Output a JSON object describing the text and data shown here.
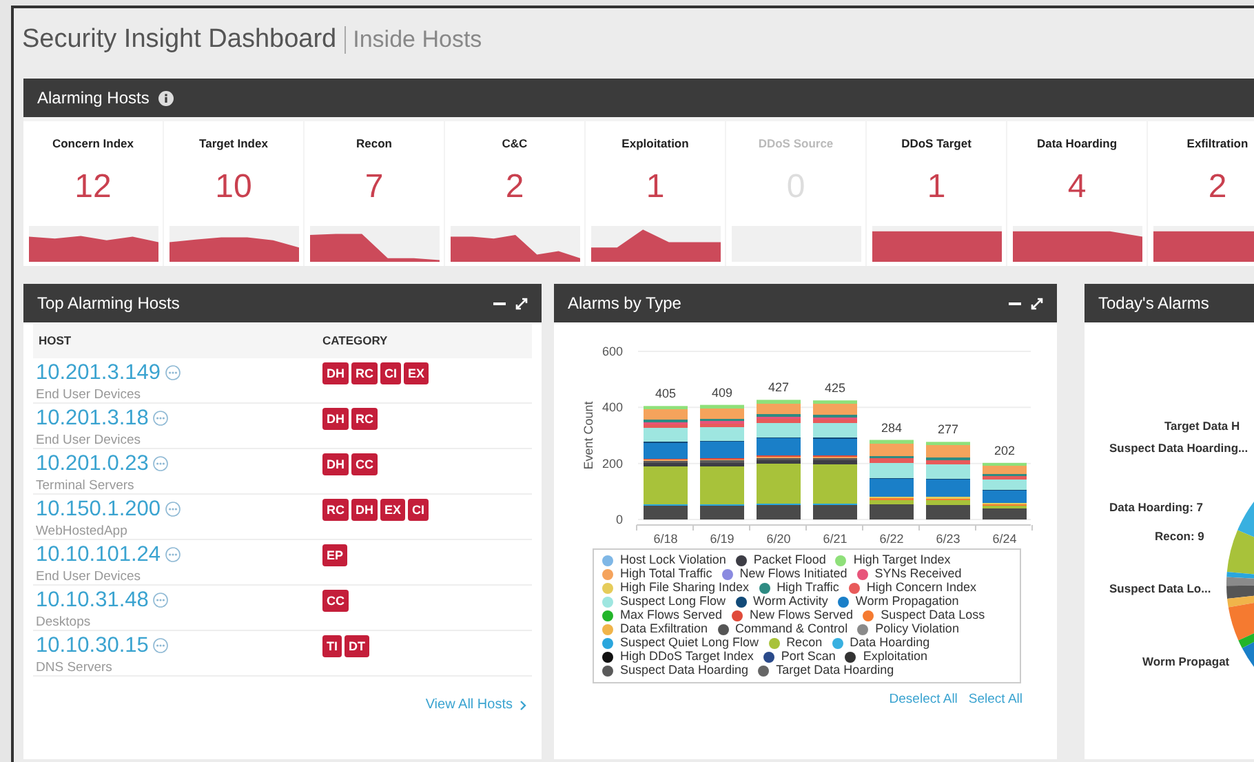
{
  "header": {
    "title": "Security Insight Dashboard",
    "subtitle": "Inside Hosts"
  },
  "alarming_hosts": {
    "title": "Alarming Hosts",
    "tiles": [
      {
        "label": "Concern Index",
        "value": "12",
        "disabled": false
      },
      {
        "label": "Target Index",
        "value": "10",
        "disabled": false
      },
      {
        "label": "Recon",
        "value": "7",
        "disabled": false
      },
      {
        "label": "C&C",
        "value": "2",
        "disabled": false
      },
      {
        "label": "Exploitation",
        "value": "1",
        "disabled": false
      },
      {
        "label": "DDoS Source",
        "value": "0",
        "disabled": true
      },
      {
        "label": "DDoS Target",
        "value": "1",
        "disabled": false
      },
      {
        "label": "Data Hoarding",
        "value": "4",
        "disabled": false
      },
      {
        "label": "Exfiltration",
        "value": "2",
        "disabled": false
      }
    ]
  },
  "top_alarming_hosts": {
    "title": "Top Alarming Hosts",
    "columns": [
      "HOST",
      "CATEGORY"
    ],
    "rows": [
      {
        "host": "10.201.3.149",
        "group": "End User Devices",
        "categories": [
          "DH",
          "RC",
          "CI",
          "EX"
        ]
      },
      {
        "host": "10.201.3.18",
        "group": "End User Devices",
        "categories": [
          "DH",
          "RC"
        ]
      },
      {
        "host": "10.201.0.23",
        "group": "Terminal Servers",
        "categories": [
          "DH",
          "CC"
        ]
      },
      {
        "host": "10.150.1.200",
        "group": "WebHostedApp",
        "categories": [
          "RC",
          "DH",
          "EX",
          "CI"
        ]
      },
      {
        "host": "10.10.101.24",
        "group": "End User Devices",
        "categories": [
          "EP"
        ]
      },
      {
        "host": "10.10.31.48",
        "group": "Desktops",
        "categories": [
          "CC"
        ]
      },
      {
        "host": "10.10.30.15",
        "group": "DNS Servers",
        "categories": [
          "TI",
          "DT"
        ]
      }
    ],
    "link": "View All Hosts"
  },
  "alarms_by_type": {
    "title": "Alarms by Type",
    "chart_data": {
      "type": "bar",
      "ylabel": "Event Count",
      "categories": [
        "6/18",
        "6/19",
        "6/20",
        "6/21",
        "6/22",
        "6/23",
        "6/24"
      ],
      "values": [
        405,
        409,
        427,
        425,
        284,
        277,
        202
      ],
      "ylim": [
        0,
        600
      ],
      "yticks": [
        0,
        200,
        400,
        600
      ],
      "data_labels": true
    },
    "legend": [
      {
        "name": "Host Lock Violation",
        "color": "#7fb7e6"
      },
      {
        "name": "Packet Flood",
        "color": "#3d3d45"
      },
      {
        "name": "High Target Index",
        "color": "#8fe07a"
      },
      {
        "name": "High Total Traffic",
        "color": "#f5a35c"
      },
      {
        "name": "New Flows Initiated",
        "color": "#8a8ae0"
      },
      {
        "name": "SYNs Received",
        "color": "#e8547a"
      },
      {
        "name": "High File Sharing Index",
        "color": "#e6cc5a"
      },
      {
        "name": "High Traffic",
        "color": "#2e8b83"
      },
      {
        "name": "High Concern Index",
        "color": "#e85a5a"
      },
      {
        "name": "Suspect Long Flow",
        "color": "#9ee6e0"
      },
      {
        "name": "Worm Activity",
        "color": "#124a78"
      },
      {
        "name": "Worm Propagation",
        "color": "#1a7fc8"
      },
      {
        "name": "Max Flows Served",
        "color": "#22b52a"
      },
      {
        "name": "New Flows Served",
        "color": "#e04a3a"
      },
      {
        "name": "Suspect Data Loss",
        "color": "#f57a30"
      },
      {
        "name": "Data Exfiltration",
        "color": "#f0b44a"
      },
      {
        "name": "Command & Control",
        "color": "#555555"
      },
      {
        "name": "Policy Violation",
        "color": "#8a8a8a"
      },
      {
        "name": "Suspect Quiet Long Flow",
        "color": "#2aa6dd"
      },
      {
        "name": "Recon",
        "color": "#a8c23a"
      },
      {
        "name": "Data Hoarding",
        "color": "#38b0e0"
      },
      {
        "name": "High DDoS Target Index",
        "color": "#111111"
      },
      {
        "name": "Port Scan",
        "color": "#2a4a8a"
      },
      {
        "name": "Exploitation",
        "color": "#333333"
      },
      {
        "name": "Suspect Data Hoarding",
        "color": "#5a5a5a"
      },
      {
        "name": "Target Data Hoarding",
        "color": "#666666"
      }
    ],
    "actions": [
      "Deselect All",
      "Select All"
    ]
  },
  "todays_alarms": {
    "title": "Today's Alarms",
    "labels": [
      "Target Data H",
      "Suspect Data Hoarding...",
      "Data Hoarding: 7",
      "Recon: 9",
      "Suspect Data Lo...",
      "Worm Propagat"
    ]
  }
}
